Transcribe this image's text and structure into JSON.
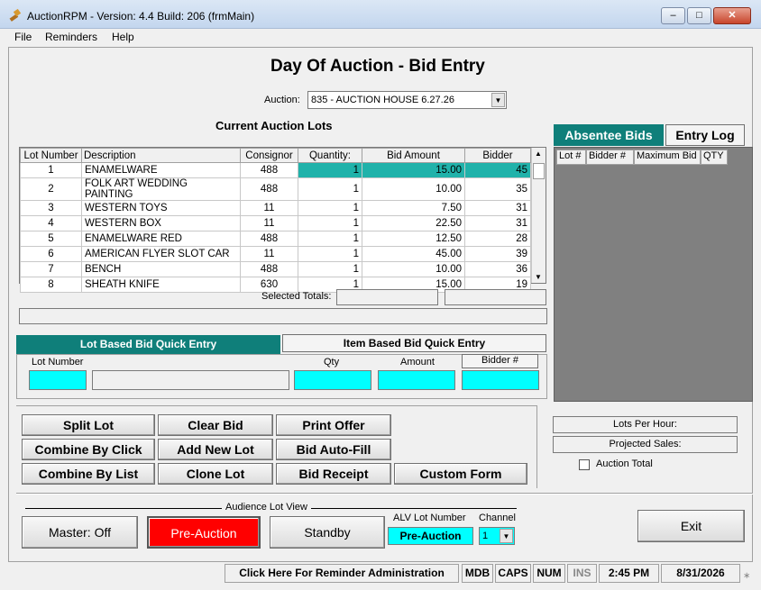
{
  "window": {
    "title": "AuctionRPM - Version: 4.4 Build: 206   (frmMain)"
  },
  "menu": [
    "File",
    "Reminders",
    "Help"
  ],
  "page_title": "Day Of Auction - Bid Entry",
  "auction": {
    "label": "Auction:",
    "value": "835 - AUCTION HOUSE 6.27.26"
  },
  "lots_heading": "Current Auction Lots",
  "lots": {
    "columns": [
      "Lot Number",
      "Description",
      "Consignor",
      "Quantity:",
      "Bid Amount",
      "Bidder"
    ],
    "rows": [
      [
        "1",
        "ENAMELWARE",
        "488",
        "1",
        "15.00",
        "45"
      ],
      [
        "2",
        "FOLK ART WEDDING PAINTING",
        "488",
        "1",
        "10.00",
        "35"
      ],
      [
        "3",
        "WESTERN TOYS",
        "11",
        "1",
        "7.50",
        "31"
      ],
      [
        "4",
        "WESTERN BOX",
        "11",
        "1",
        "22.50",
        "31"
      ],
      [
        "5",
        "ENAMELWARE RED",
        "488",
        "1",
        "12.50",
        "28"
      ],
      [
        "6",
        "AMERICAN FLYER SLOT CAR",
        "11",
        "1",
        "45.00",
        "39"
      ],
      [
        "7",
        "BENCH",
        "488",
        "1",
        "10.00",
        "36"
      ],
      [
        "8",
        "SHEATH KNIFE",
        "630",
        "1",
        "15.00",
        "19"
      ]
    ]
  },
  "selected_totals_label": "Selected Totals:",
  "side_tabs": {
    "absentee": "Absentee Bids",
    "entry_log": "Entry Log"
  },
  "absentee_columns": [
    "Lot #",
    "Bidder #",
    "Maximum Bid",
    "QTY"
  ],
  "quick_entry": {
    "lot_tab": "Lot Based Bid Quick Entry",
    "item_tab": "Item Based Bid Quick Entry",
    "lot_number_label": "Lot Number",
    "qty_label": "Qty",
    "amount_label": "Amount",
    "bidder_label": "Bidder #"
  },
  "actions": {
    "split_lot": "Split Lot",
    "clear_bid": "Clear Bid",
    "print_offer": "Print Offer",
    "combine_by_click": "Combine By Click",
    "add_new_lot": "Add New Lot",
    "bid_auto_fill": "Bid Auto-Fill",
    "combine_by_list": "Combine By List",
    "clone_lot": "Clone Lot",
    "bid_receipt": "Bid Receipt",
    "custom_form": "Custom Form"
  },
  "stats": {
    "lots_per_hour": "Lots Per Hour:",
    "projected_sales": "Projected Sales:",
    "auction_total": "Auction Total"
  },
  "alv": {
    "group_label": "Audience Lot View",
    "master": "Master: Off",
    "pre_auction": "Pre-Auction",
    "standby": "Standby",
    "lot_number_label": "ALV Lot Number",
    "lot_number_value": "Pre-Auction",
    "channel_label": "Channel",
    "channel_value": "1"
  },
  "exit": "Exit",
  "statusbar": {
    "reminder": "Click Here For Reminder Administration",
    "mdb": "MDB",
    "caps": "CAPS",
    "num": "NUM",
    "ins": "INS",
    "time": "2:45 PM",
    "date": "8/31/2026"
  },
  "colors": {
    "teal": "#0f7f7a",
    "cyan": "#00ffff",
    "red": "#ff0000",
    "highlight": "#20b2aa"
  }
}
